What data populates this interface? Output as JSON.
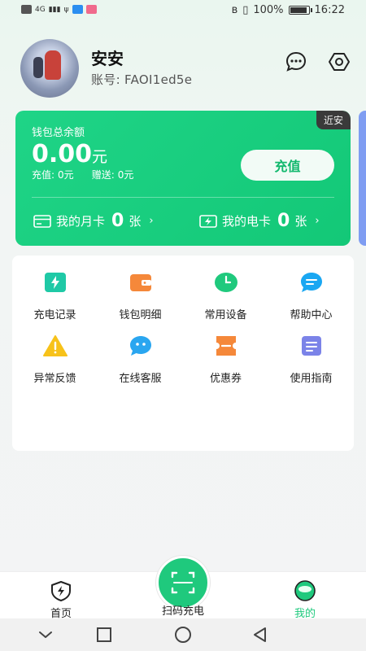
{
  "status_bar": {
    "network": "4G",
    "battery": "100%",
    "battery_level": 1.0,
    "time": "16:22"
  },
  "profile": {
    "name": "安安",
    "account_label": "账号:",
    "account_id": "FAOI1ed5e"
  },
  "header_icons": [
    "message-icon",
    "settings-icon"
  ],
  "wallet": {
    "tag": "近安",
    "title": "钱包总余额",
    "amount": "0.00",
    "unit": "元",
    "recharge_label": "充值:",
    "recharge_value": "0元",
    "gift_label": "赠送:",
    "gift_value": "0元",
    "recharge_button": "充值",
    "monthly_card_label": "我的月卡",
    "monthly_card_count": "0",
    "monthly_card_unit": "张",
    "e_card_label": "我的电卡",
    "e_card_count": "0",
    "e_card_unit": "张"
  },
  "grid": [
    {
      "label": "充电记录",
      "icon": "charge-record-icon",
      "color": "#1fc9a6"
    },
    {
      "label": "钱包明细",
      "icon": "wallet-icon",
      "color": "#f5883a"
    },
    {
      "label": "常用设备",
      "icon": "clock-icon",
      "color": "#1fc97d"
    },
    {
      "label": "帮助中心",
      "icon": "help-chat-icon",
      "color": "#1aa7f2"
    },
    {
      "label": "异常反馈",
      "icon": "warning-icon",
      "color": "#f7c21a"
    },
    {
      "label": "在线客服",
      "icon": "service-chat-icon",
      "color": "#2aa6f0"
    },
    {
      "label": "优惠券",
      "icon": "coupon-icon",
      "color": "#f5883a"
    },
    {
      "label": "使用指南",
      "icon": "guide-icon",
      "color": "#7b83e8"
    }
  ],
  "tabs": {
    "home": "首页",
    "scan": "扫码充电",
    "mine": "我的"
  },
  "colors": {
    "brand": "#1fd487",
    "active_tab": "#1fc97d"
  }
}
